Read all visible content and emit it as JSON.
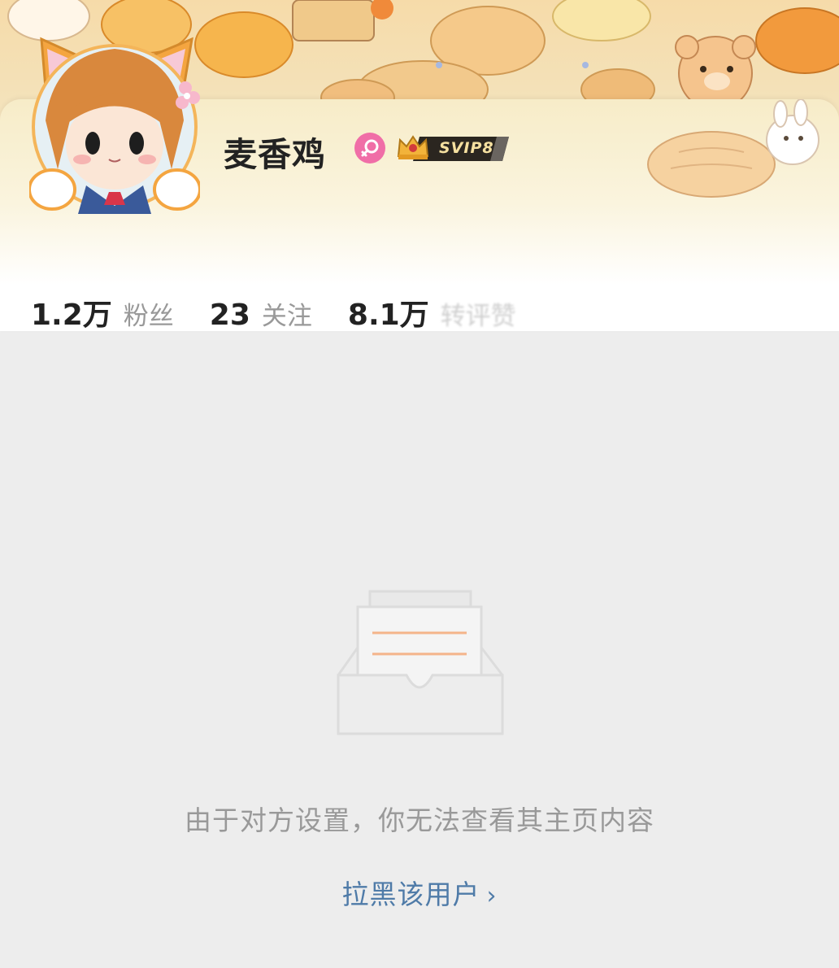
{
  "profile": {
    "username": "麦香鸡",
    "gender_icon": "female-icon",
    "vip_badge": "SVIP8",
    "accent_color": "#f06ea7"
  },
  "stats": [
    {
      "value": "1.2万",
      "label": "粉丝"
    },
    {
      "value": "23",
      "label": "关注"
    },
    {
      "value": "8.1万",
      "label": "转评赞"
    }
  ],
  "empty_state": {
    "icon": "empty-inbox-icon",
    "message": "由于对方设置，你无法查看其主页内容",
    "action_label": "拉黑该用户",
    "action_icon": "chevron-right-icon",
    "action_color": "#4f7ba8"
  }
}
